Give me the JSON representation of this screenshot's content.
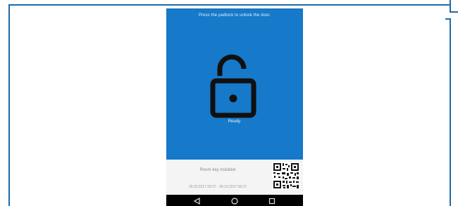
{
  "screen": {
    "instruction": "Press the padlock to unlock the door.",
    "status": "Ready.",
    "lock_icon": "padlock-unlocked-icon",
    "background_color": "#1679c9"
  },
  "key_panel": {
    "status": "Room key installed",
    "validity": "29.03.2017 09:27 - 28.10.2017 09:27",
    "qr_icon": "qr-code-icon"
  },
  "navigation": {
    "back_icon": "back-triangle-icon",
    "home_icon": "home-circle-icon",
    "recents_icon": "recents-square-icon"
  }
}
